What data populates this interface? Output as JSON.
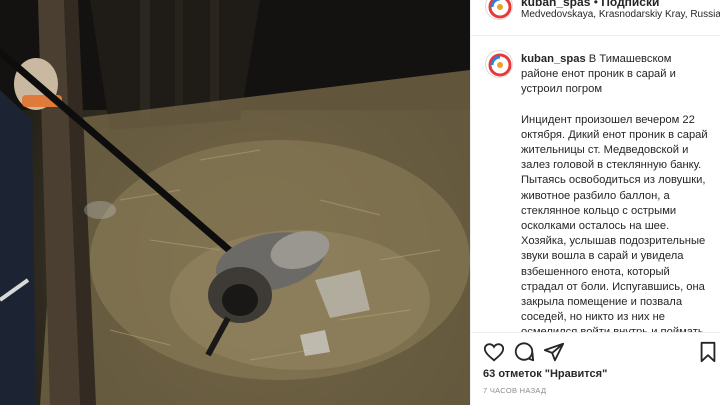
{
  "post": {
    "username": "kuban_spas",
    "separator": "•",
    "follow_label": "Подписки",
    "location": "Medvedovskaya, Krasnodarskiy Kray, Russia"
  },
  "caption": {
    "username": "kuban_spas",
    "headline": "В Тимашевском районе енот проник в сарай и устроил погром",
    "body": "Инцидент произошел вечером 22 октября. Дикий енот проник в сарай жительницы ст. Медведовской и залез головой в стеклянную банку. Пытаясь освободиться из ловушки, животное разбило баллон, а стеклянное кольцо с острыми осколками осталось на шее. Хозяйка, услышав подозрительные звуки вошла в сарай и увидела взбешенного енота, который страдал от боли. Испугавшись, она закрыла помещение и позвала соседей, но никто из них не осмелился войти внутрь и поймать хищника. Женщина обратилась к"
  },
  "actions": {
    "like_icon": "heart-icon",
    "comment_icon": "comment-icon",
    "share_icon": "paper-plane-icon",
    "save_icon": "bookmark-icon",
    "likes_count": "63",
    "likes_text": "отметок \"Нравится\"",
    "time_ago": "7 ЧАСОВ НАЗАД"
  },
  "colors": {
    "text": "#262626",
    "muted": "#8e8e8e",
    "divider": "#efefef"
  }
}
